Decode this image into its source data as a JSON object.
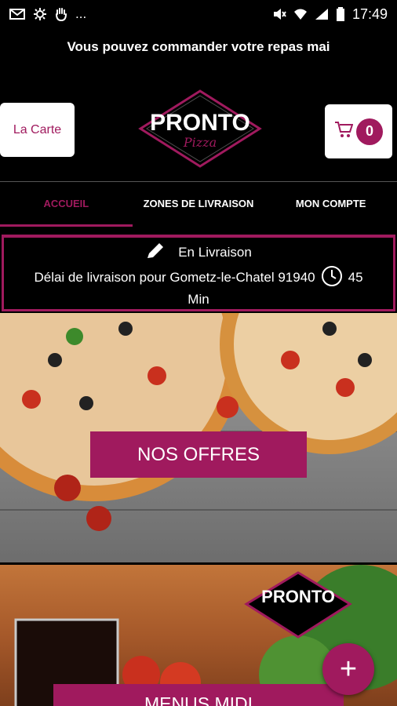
{
  "status_bar": {
    "time": "17:49",
    "more": "..."
  },
  "marquee_text": "Vous pouvez commander votre repas mai",
  "header": {
    "carte_label": "La Carte",
    "cart_count": "0",
    "logo_main": "PRONTO",
    "logo_sub": "Pizza"
  },
  "tabs": [
    {
      "label": "ACCUEIL",
      "active": true
    },
    {
      "label": "ZONES DE LIVRAISON",
      "active": false
    },
    {
      "label": "MON COMPTE",
      "active": false
    }
  ],
  "delivery": {
    "mode": "En Livraison",
    "line": "Délai de livraison pour Gometz-le-Chatel 91940",
    "minutes": "45",
    "unit": "Min"
  },
  "banners": {
    "offres_label": "NOS OFFRES",
    "menus_label": "MENUS MIDI"
  },
  "fab_label": "+",
  "colors": {
    "accent": "#a01a5e",
    "background": "#000000"
  }
}
